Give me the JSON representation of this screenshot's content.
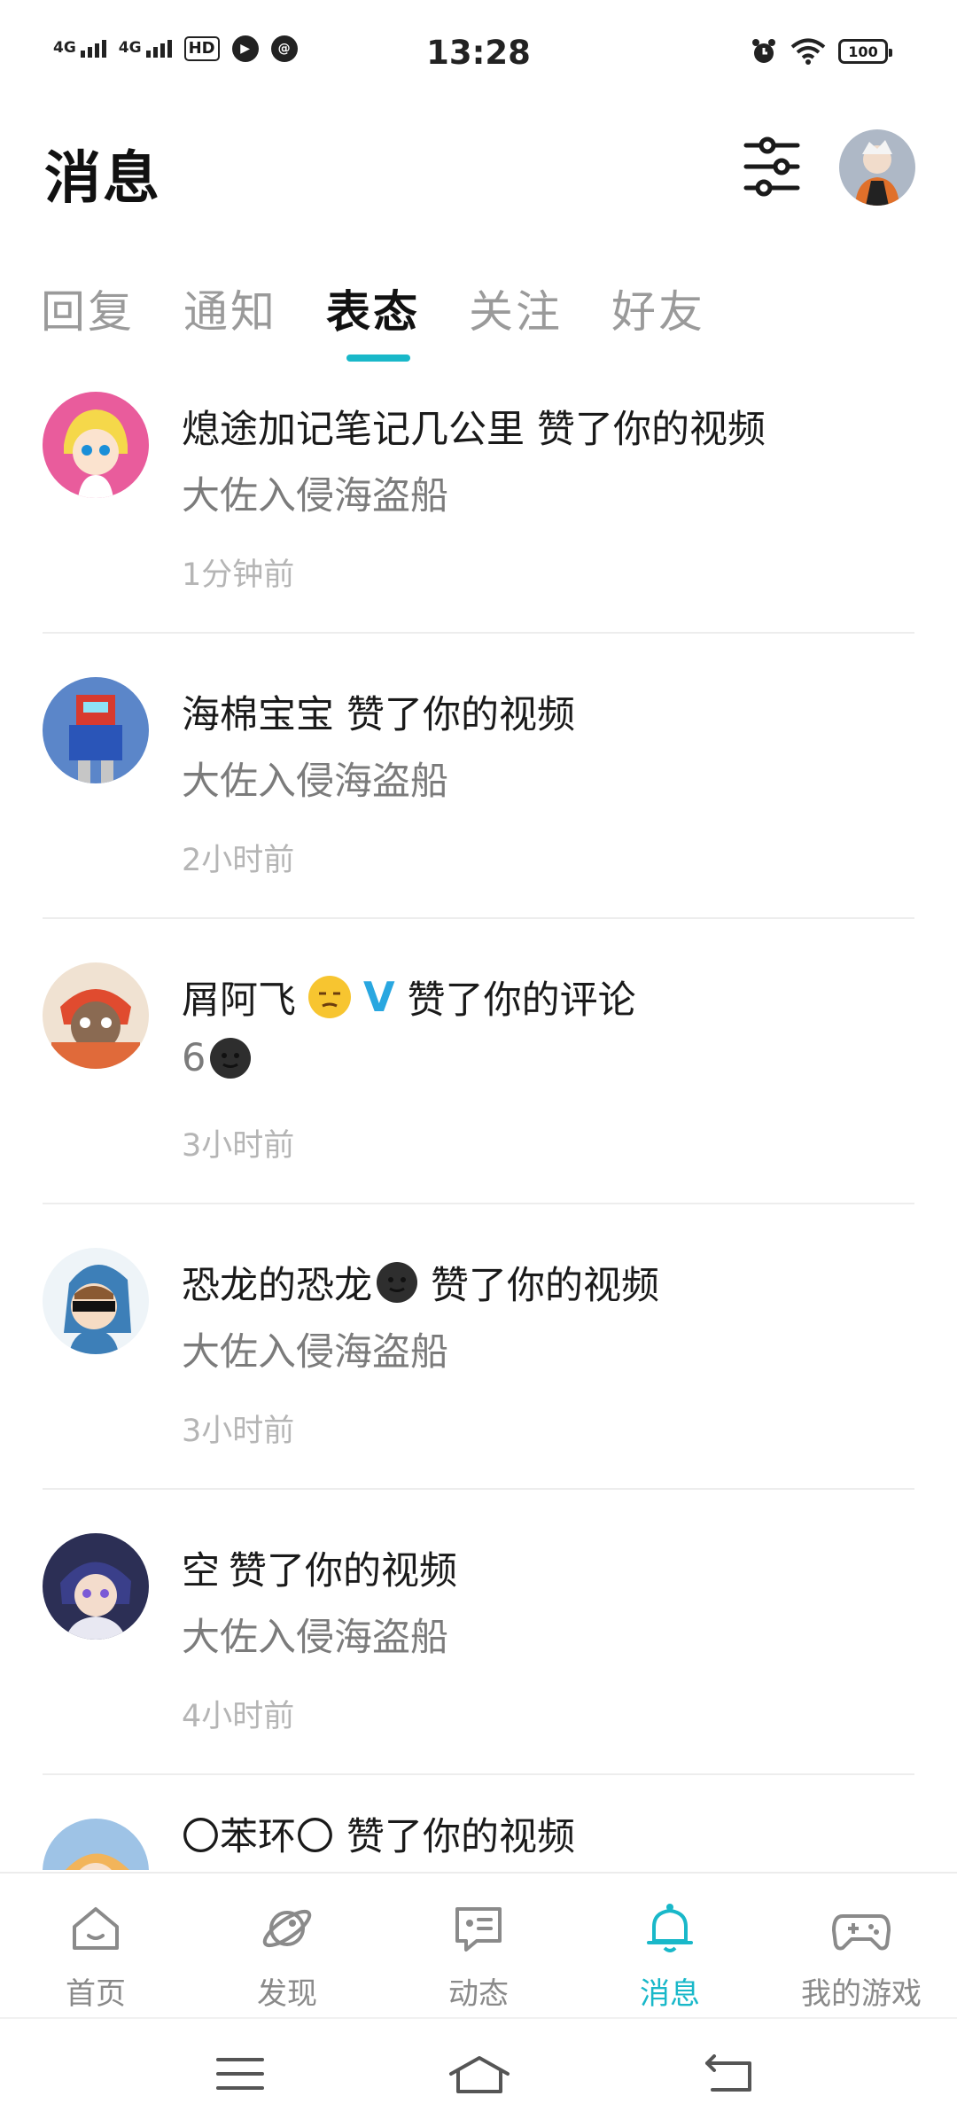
{
  "status_bar": {
    "signal1_label": "4G",
    "signal2_label": "4G",
    "hd_label": "HD",
    "time": "13:28",
    "battery": "100"
  },
  "header": {
    "title": "消息",
    "filter_icon": "sliders-icon",
    "avatar_icon": "user-avatar"
  },
  "tabs": [
    {
      "label": "回复",
      "active": false
    },
    {
      "label": "通知",
      "active": false
    },
    {
      "label": "表态",
      "active": true
    },
    {
      "label": "关注",
      "active": false
    },
    {
      "label": "好友",
      "active": false
    }
  ],
  "accent_color": "#19b8c9",
  "notifications": [
    {
      "user": "熄途加记笔记几公里",
      "action": "赞了你的视频",
      "content": "大佐入侵海盗船",
      "time": "1分钟前"
    },
    {
      "user": "海棉宝宝",
      "action": "赞了你的视频",
      "content": "大佐入侵海盗船",
      "time": "2小时前"
    },
    {
      "user": "屑阿飞",
      "action": "赞了你的评论",
      "content": "6",
      "time": "3小时前"
    },
    {
      "user": "恐龙的恐龙",
      "action": "赞了你的视频",
      "content": "大佐入侵海盗船",
      "time": "3小时前"
    },
    {
      "user": "空",
      "action": "赞了你的视频",
      "content": "大佐入侵海盗船",
      "time": "4小时前"
    },
    {
      "user": "〇苯环〇",
      "action": "赞了你的视频",
      "content": "",
      "time": ""
    }
  ],
  "bottom_nav": [
    {
      "label": "首页",
      "icon": "home-icon",
      "active": false
    },
    {
      "label": "发现",
      "icon": "planet-icon",
      "active": false
    },
    {
      "label": "动态",
      "icon": "chat-card-icon",
      "active": false
    },
    {
      "label": "消息",
      "icon": "bell-icon",
      "active": true
    },
    {
      "label": "我的游戏",
      "icon": "gamepad-icon",
      "active": false
    }
  ]
}
